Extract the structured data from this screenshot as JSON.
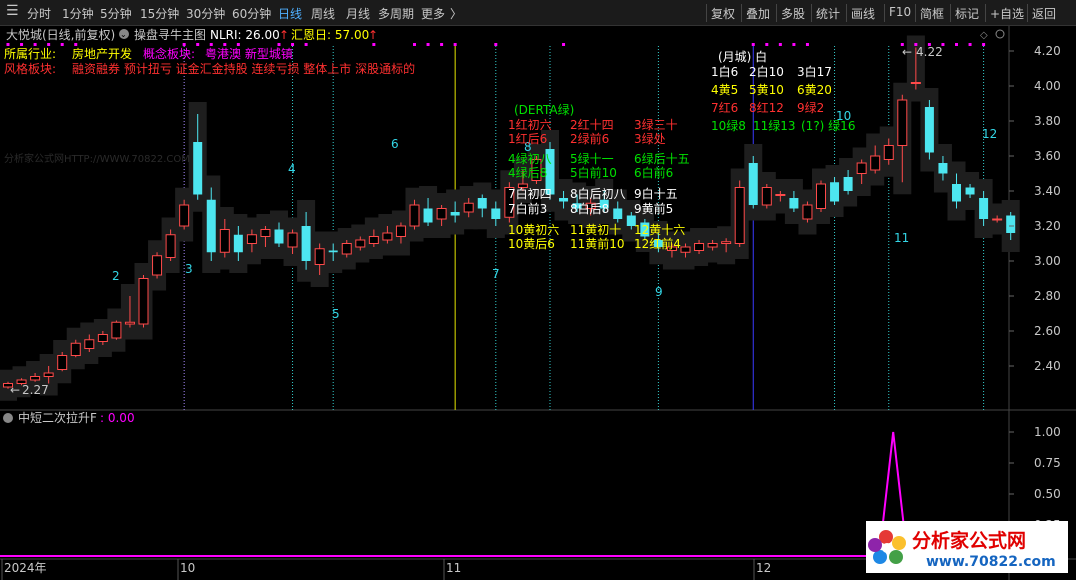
{
  "toolbar": {
    "left": [
      "分时",
      "1分钟",
      "5分钟",
      "15分钟",
      "30分钟",
      "60分钟",
      "日线",
      "周线",
      "月线",
      "多周期",
      "更多"
    ],
    "active": "日线",
    "more_arrow": "〉",
    "right": [
      "复权",
      "叠加",
      "多股",
      "统计",
      "画线",
      "F10",
      "简框",
      "标记",
      "+自选",
      "返回"
    ]
  },
  "header": {
    "stock_title": "大悦城(日线,前复权)",
    "indicator_name": "操盘寻牛主图",
    "nlri_label": "NLRI: 26.00",
    "nlri_arrow": "↑",
    "huien_label": "汇恩日: 57.00",
    "huien_arrow": "↑"
  },
  "info": {
    "industry_label": "所属行业:",
    "industry_value": "房地产开发",
    "concept_label": "概念板块:",
    "concept_value": "粤港澳 新型城镇",
    "style_label": "风格板块:",
    "style_value": "融资融券 预计扭亏 证金汇金持股 连续亏损 整体上市 深股通标的"
  },
  "watermark_faint": "分析家公式网HTTP://WWW.70822.COM",
  "price_axis": [
    "4.20",
    "4.00",
    "3.80",
    "3.60",
    "3.40",
    "3.20",
    "3.00",
    "2.80",
    "2.60",
    "2.40"
  ],
  "annotations": {
    "low": "2.27",
    "high": "4.22"
  },
  "cycle_labels": [
    "2",
    "3",
    "4",
    "5",
    "6",
    "7",
    "8",
    "9",
    "10",
    "11",
    "12"
  ],
  "month_table": {
    "title": "(月城) 白",
    "rows": [
      [
        {
          "t": "1白6",
          "c": "#ffffff"
        },
        {
          "t": "2白10",
          "c": "#ffffff"
        },
        {
          "t": "3白17",
          "c": "#ffffff"
        }
      ],
      [
        {
          "t": "4黄5",
          "c": "#ffff00"
        },
        {
          "t": "5黄10",
          "c": "#ffff00"
        },
        {
          "t": "6黄20",
          "c": "#ffff00"
        }
      ],
      [
        {
          "t": "7红6",
          "c": "#ff3030"
        },
        {
          "t": "8红12",
          "c": "#ff3030"
        },
        {
          "t": "9绿2",
          "c": "#ff3030"
        }
      ],
      [
        {
          "t": "10绿8",
          "c": "#00e000"
        },
        {
          "t": "11绿13",
          "c": "#00e000"
        },
        {
          "t": "(1?) 绿16",
          "c": "#00e000"
        }
      ]
    ]
  },
  "derta_table": {
    "title": "(DERTA绿)",
    "rows": [
      [
        {
          "t": "1红初六",
          "c": "#ff3030"
        },
        {
          "t": "2红十四",
          "c": "#ff3030"
        },
        {
          "t": "3绿三十",
          "c": "#ff3030"
        }
      ],
      [
        {
          "t": "1红后6",
          "c": "#ff3030"
        },
        {
          "t": "2绿前6",
          "c": "#ff3030"
        },
        {
          "t": "3绿处",
          "c": "#ff3030"
        }
      ],
      [
        {
          "t": "4绿初八",
          "c": "#00e000"
        },
        {
          "t": "5绿十一",
          "c": "#00e000"
        },
        {
          "t": "6绿后十五",
          "c": "#00e000"
        }
      ],
      [
        {
          "t": "4绿后8",
          "c": "#00e000"
        },
        {
          "t": "5白前10",
          "c": "#00e000"
        },
        {
          "t": "6白前6",
          "c": "#00e000"
        }
      ],
      [
        {
          "t": "7白初四",
          "c": "#ffffff"
        },
        {
          "t": "8白后初八",
          "c": "#ffffff"
        },
        {
          "t": "9白十五",
          "c": "#ffffff"
        }
      ],
      [
        {
          "t": "7白前3",
          "c": "#ffffff"
        },
        {
          "t": "8白后8",
          "c": "#ffffff"
        },
        {
          "t": "9黄前5",
          "c": "#ffffff"
        }
      ],
      [
        {
          "t": "10黄初六",
          "c": "#ffff00"
        },
        {
          "t": "11黄初十",
          "c": "#ffff00"
        },
        {
          "t": "12黄十六",
          "c": "#ffff00"
        }
      ],
      [
        {
          "t": "10黄后6",
          "c": "#ffff00"
        },
        {
          "t": "11黄前10",
          "c": "#ffff00"
        },
        {
          "t": "12红前4",
          "c": "#ffff00"
        }
      ]
    ]
  },
  "sub_panel": {
    "title": "中短二次拉升F",
    "value": ": 0.00",
    "axis": [
      "1.00",
      "0.75",
      "0.50",
      "0.25",
      "0.00"
    ]
  },
  "date_axis": [
    "2024年",
    "10",
    "11",
    "12"
  ],
  "logo": {
    "cn": "分析家公式网",
    "url": "www.70822.com"
  },
  "colors": {
    "up": "#ff4a4a",
    "down": "#4de6f0",
    "signal": "#ff00ff",
    "vline_yellow": "#e6e600",
    "vline_blue": "#3a3aff",
    "vline_cyan": "#33cccc",
    "label_cyan": "#33d6e6"
  },
  "chart_data": {
    "type": "candlestick",
    "price_range": [
      2.27,
      4.22
    ],
    "candles": [
      {
        "o": 2.28,
        "h": 2.31,
        "l": 2.27,
        "c": 2.3
      },
      {
        "o": 2.3,
        "h": 2.33,
        "l": 2.29,
        "c": 2.32
      },
      {
        "o": 2.32,
        "h": 2.36,
        "l": 2.31,
        "c": 2.34
      },
      {
        "o": 2.34,
        "h": 2.4,
        "l": 2.3,
        "c": 2.36
      },
      {
        "o": 2.38,
        "h": 2.48,
        "l": 2.37,
        "c": 2.46
      },
      {
        "o": 2.46,
        "h": 2.55,
        "l": 2.45,
        "c": 2.53
      },
      {
        "o": 2.5,
        "h": 2.58,
        "l": 2.48,
        "c": 2.55
      },
      {
        "o": 2.54,
        "h": 2.6,
        "l": 2.52,
        "c": 2.58
      },
      {
        "o": 2.56,
        "h": 2.66,
        "l": 2.55,
        "c": 2.65
      },
      {
        "o": 2.64,
        "h": 2.8,
        "l": 2.62,
        "c": 2.65
      },
      {
        "o": 2.64,
        "h": 2.92,
        "l": 2.62,
        "c": 2.9
      },
      {
        "o": 2.92,
        "h": 3.05,
        "l": 2.9,
        "c": 3.03
      },
      {
        "o": 3.02,
        "h": 3.18,
        "l": 3.0,
        "c": 3.15
      },
      {
        "o": 3.2,
        "h": 3.35,
        "l": 3.18,
        "c": 3.32
      },
      {
        "o": 3.68,
        "h": 3.84,
        "l": 3.35,
        "c": 3.38
      },
      {
        "o": 3.35,
        "h": 3.42,
        "l": 3.0,
        "c": 3.05
      },
      {
        "o": 3.05,
        "h": 3.24,
        "l": 3.02,
        "c": 3.18
      },
      {
        "o": 3.15,
        "h": 3.2,
        "l": 3.0,
        "c": 3.05
      },
      {
        "o": 3.1,
        "h": 3.18,
        "l": 3.05,
        "c": 3.15
      },
      {
        "o": 3.14,
        "h": 3.2,
        "l": 3.08,
        "c": 3.18
      },
      {
        "o": 3.18,
        "h": 3.22,
        "l": 3.08,
        "c": 3.1
      },
      {
        "o": 3.08,
        "h": 3.18,
        "l": 3.04,
        "c": 3.16
      },
      {
        "o": 3.2,
        "h": 3.28,
        "l": 2.95,
        "c": 3.0
      },
      {
        "o": 2.98,
        "h": 3.1,
        "l": 2.92,
        "c": 3.07
      },
      {
        "o": 3.06,
        "h": 3.1,
        "l": 3.0,
        "c": 3.05
      },
      {
        "o": 3.04,
        "h": 3.12,
        "l": 3.02,
        "c": 3.1
      },
      {
        "o": 3.08,
        "h": 3.14,
        "l": 3.06,
        "c": 3.12
      },
      {
        "o": 3.1,
        "h": 3.18,
        "l": 3.08,
        "c": 3.14
      },
      {
        "o": 3.12,
        "h": 3.2,
        "l": 3.1,
        "c": 3.16
      },
      {
        "o": 3.14,
        "h": 3.22,
        "l": 3.1,
        "c": 3.2
      },
      {
        "o": 3.2,
        "h": 3.35,
        "l": 3.18,
        "c": 3.32
      },
      {
        "o": 3.3,
        "h": 3.36,
        "l": 3.2,
        "c": 3.22
      },
      {
        "o": 3.24,
        "h": 3.32,
        "l": 3.2,
        "c": 3.3
      },
      {
        "o": 3.28,
        "h": 3.34,
        "l": 3.22,
        "c": 3.26
      },
      {
        "o": 3.28,
        "h": 3.36,
        "l": 3.25,
        "c": 3.33
      },
      {
        "o": 3.36,
        "h": 3.38,
        "l": 3.25,
        "c": 3.3
      },
      {
        "o": 3.3,
        "h": 3.34,
        "l": 3.2,
        "c": 3.24
      },
      {
        "o": 3.25,
        "h": 3.45,
        "l": 3.22,
        "c": 3.42
      },
      {
        "o": 3.42,
        "h": 3.52,
        "l": 3.4,
        "c": 3.44
      },
      {
        "o": 3.46,
        "h": 3.6,
        "l": 3.44,
        "c": 3.58
      },
      {
        "o": 3.64,
        "h": 3.68,
        "l": 3.35,
        "c": 3.38
      },
      {
        "o": 3.36,
        "h": 3.4,
        "l": 3.3,
        "c": 3.34
      },
      {
        "o": 3.33,
        "h": 3.38,
        "l": 3.28,
        "c": 3.3
      },
      {
        "o": 3.3,
        "h": 3.36,
        "l": 3.26,
        "c": 3.33
      },
      {
        "o": 3.35,
        "h": 3.4,
        "l": 3.28,
        "c": 3.3
      },
      {
        "o": 3.3,
        "h": 3.34,
        "l": 3.22,
        "c": 3.24
      },
      {
        "o": 3.26,
        "h": 3.28,
        "l": 3.18,
        "c": 3.2
      },
      {
        "o": 3.22,
        "h": 3.24,
        "l": 3.12,
        "c": 3.14
      },
      {
        "o": 3.12,
        "h": 3.16,
        "l": 3.05,
        "c": 3.08
      },
      {
        "o": 3.06,
        "h": 3.1,
        "l": 3.02,
        "c": 3.08
      },
      {
        "o": 3.05,
        "h": 3.1,
        "l": 3.02,
        "c": 3.08
      },
      {
        "o": 3.06,
        "h": 3.12,
        "l": 3.04,
        "c": 3.1
      },
      {
        "o": 3.08,
        "h": 3.12,
        "l": 3.06,
        "c": 3.1
      },
      {
        "o": 3.1,
        "h": 3.13,
        "l": 3.05,
        "c": 3.11
      },
      {
        "o": 3.1,
        "h": 3.46,
        "l": 3.08,
        "c": 3.42
      },
      {
        "o": 3.56,
        "h": 3.6,
        "l": 3.3,
        "c": 3.32
      },
      {
        "o": 3.32,
        "h": 3.44,
        "l": 3.3,
        "c": 3.42
      },
      {
        "o": 3.38,
        "h": 3.4,
        "l": 3.34,
        "c": 3.38
      },
      {
        "o": 3.36,
        "h": 3.4,
        "l": 3.28,
        "c": 3.3
      },
      {
        "o": 3.24,
        "h": 3.34,
        "l": 3.22,
        "c": 3.32
      },
      {
        "o": 3.3,
        "h": 3.46,
        "l": 3.28,
        "c": 3.44
      },
      {
        "o": 3.45,
        "h": 3.48,
        "l": 3.32,
        "c": 3.34
      },
      {
        "o": 3.48,
        "h": 3.52,
        "l": 3.38,
        "c": 3.4
      },
      {
        "o": 3.5,
        "h": 3.58,
        "l": 3.44,
        "c": 3.56
      },
      {
        "o": 3.52,
        "h": 3.66,
        "l": 3.5,
        "c": 3.6
      },
      {
        "o": 3.58,
        "h": 3.7,
        "l": 3.55,
        "c": 3.66
      },
      {
        "o": 3.66,
        "h": 3.95,
        "l": 3.45,
        "c": 3.92
      },
      {
        "o": 4.02,
        "h": 4.22,
        "l": 3.98,
        "c": 4.02
      },
      {
        "o": 3.88,
        "h": 3.92,
        "l": 3.58,
        "c": 3.62
      },
      {
        "o": 3.56,
        "h": 3.6,
        "l": 3.46,
        "c": 3.5
      },
      {
        "o": 3.44,
        "h": 3.5,
        "l": 3.3,
        "c": 3.34
      },
      {
        "o": 3.42,
        "h": 3.44,
        "l": 3.36,
        "c": 3.38
      },
      {
        "o": 3.36,
        "h": 3.4,
        "l": 3.2,
        "c": 3.24
      },
      {
        "o": 3.24,
        "h": 3.26,
        "l": 3.22,
        "c": 3.24
      },
      {
        "o": 3.26,
        "h": 3.28,
        "l": 3.12,
        "c": 3.16
      }
    ],
    "signal_series": {
      "name": "中短二次拉升F",
      "spike_index": 64,
      "values_note": "0 everywhere except 1.00 at spike"
    }
  }
}
